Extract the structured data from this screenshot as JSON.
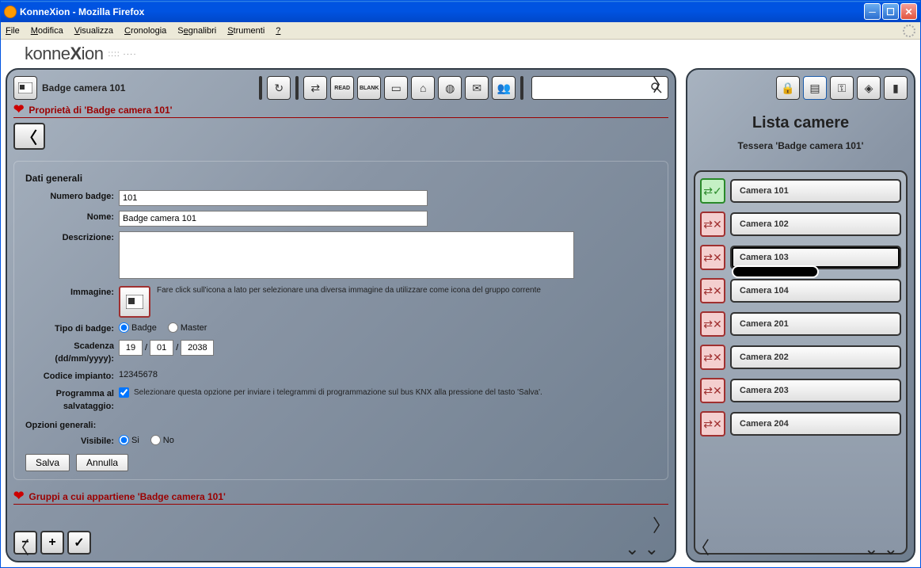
{
  "window": {
    "title": "KonneXion - Mozilla Firefox"
  },
  "menu": {
    "file": "File",
    "edit": "Modifica",
    "view": "Visualizza",
    "history": "Cronologia",
    "bookmarks": "Segnalibri",
    "tools": "Strumenti",
    "help": "?"
  },
  "brand": {
    "pre": "konne",
    "bold": "X",
    "post": "ion"
  },
  "left": {
    "badge_label": "Badge camera 101",
    "section_properties": "Proprietà di 'Badge camera 101'",
    "section_groups": "Gruppi a cui appartiene 'Badge camera 101'",
    "form": {
      "title": "Dati generali",
      "numero_label": "Numero badge:",
      "numero_value": "101",
      "nome_label": "Nome:",
      "nome_value": "Badge camera 101",
      "desc_label": "Descrizione:",
      "desc_value": "",
      "img_label": "Immagine:",
      "img_help": "Fare click sull'icona a lato per selezionare una diversa immagine da utilizzare come icona del gruppo corrente",
      "tipo_label": "Tipo di badge:",
      "tipo_badge": "Badge",
      "tipo_master": "Master",
      "scad_label": "Scadenza (dd/mm/yyyy):",
      "scad_dd": "19",
      "scad_mm": "01",
      "scad_yy": "2038",
      "codice_label": "Codice impianto:",
      "codice_value": "12345678",
      "prog_label": "Programma al salvataggio:",
      "prog_help": "Selezionare questa opzione per inviare i telegrammi di programmazione sul bus KNX alla pressione del tasto 'Salva'.",
      "opz_title": "Opzioni generali:",
      "vis_label": "Visibile:",
      "vis_si": "Si",
      "vis_no": "No",
      "save": "Salva",
      "cancel": "Annulla"
    },
    "toolbar_labels": {
      "read": "READ",
      "blank": "BLANK"
    }
  },
  "right": {
    "title": "Lista camere",
    "subtitle": "Tessera 'Badge camera 101'",
    "cameras": [
      {
        "label": "Camera 101",
        "ok": true
      },
      {
        "label": "Camera 102",
        "ok": false
      },
      {
        "label": "Camera 103",
        "ok": false,
        "selected": true,
        "tooltip": true
      },
      {
        "label": "Camera 104",
        "ok": false
      },
      {
        "label": "Camera 201",
        "ok": false
      },
      {
        "label": "Camera 202",
        "ok": false
      },
      {
        "label": "Camera 203",
        "ok": false
      },
      {
        "label": "Camera 204",
        "ok": false
      }
    ]
  }
}
